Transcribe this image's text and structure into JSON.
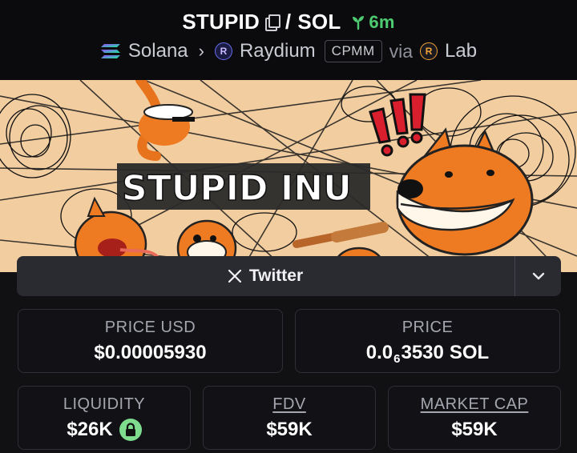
{
  "header": {
    "base_token": "STUPID",
    "separator": "/",
    "quote_token": "SOL",
    "age": "6m",
    "chain": "Solana",
    "dex": "Raydium",
    "pool_type": "CPMM",
    "via": "via",
    "launchpad": "Lab",
    "icons": [
      "copy-icon",
      "sprout-icon",
      "solana-logo",
      "chevron-right-icon",
      "raydium-logo",
      "lab-logo"
    ]
  },
  "banner": {
    "image_text": "STUPID INU"
  },
  "links": {
    "twitter_label": "Twitter",
    "icons": [
      "x-logo-icon",
      "chevron-down-icon"
    ]
  },
  "stats": {
    "price_usd_label": "PRICE USD",
    "price_usd_value": "$0.00005930",
    "price_label": "PRICE",
    "price_prefix": "0.0",
    "price_zero_count": "6",
    "price_digits": "3530",
    "price_unit": "SOL",
    "liquidity_label": "LIQUIDITY",
    "liquidity_value": "$26K",
    "fdv_label": "FDV",
    "fdv_value": "$59K",
    "market_cap_label": "MARKET CAP",
    "market_cap_value": "$59K"
  },
  "colors": {
    "background": "#111114",
    "age_green": "#4ecb71",
    "lock_green": "#7fdc8e",
    "banner_bg": "#f2cda0",
    "mascot_orange": "#ee7a22"
  }
}
